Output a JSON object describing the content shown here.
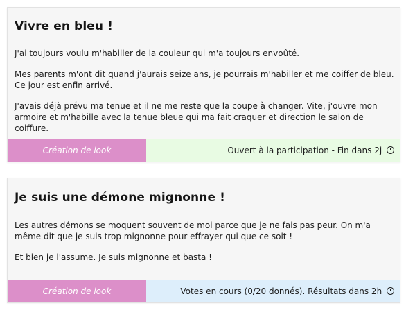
{
  "colors": {
    "card_background": "#f6f6f6",
    "category_tag": "#dc8fc9",
    "status_open": "#e8fbe3",
    "status_voting": "#ddeefb"
  },
  "challenges": [
    {
      "title": "Vivre en bleu !",
      "paragraphs": [
        "J'ai toujours voulu m'habiller de la couleur qui m'a toujours envoûté.",
        "Mes parents m'ont dit quand j'aurais seize ans, je pourrais m'habiller et me coiffer de bleu. Ce jour est enfin arrivé.",
        "J'avais déjà prévu ma tenue et il ne me reste que la coupe à changer. Vite, j'ouvre mon armoire et m'habille avec la tenue bleue qui ma fait craquer et direction le salon de coiffure."
      ],
      "category": "Création de look",
      "status": "Ouvert à la participation - Fin dans 2j",
      "status_icon": "clock-icon"
    },
    {
      "title": "Je suis une démone mignonne !",
      "paragraphs": [
        "Les autres démons se moquent souvent de moi parce que je ne fais pas peur. On m'a même dit que je suis trop mignonne pour effrayer qui que ce soit !",
        "Et bien je l'assume. Je suis mignonne et basta !"
      ],
      "category": "Création de look",
      "status": "Votes en cours (0/20 donnés). Résultats dans 2h",
      "status_icon": "clock-icon"
    }
  ]
}
